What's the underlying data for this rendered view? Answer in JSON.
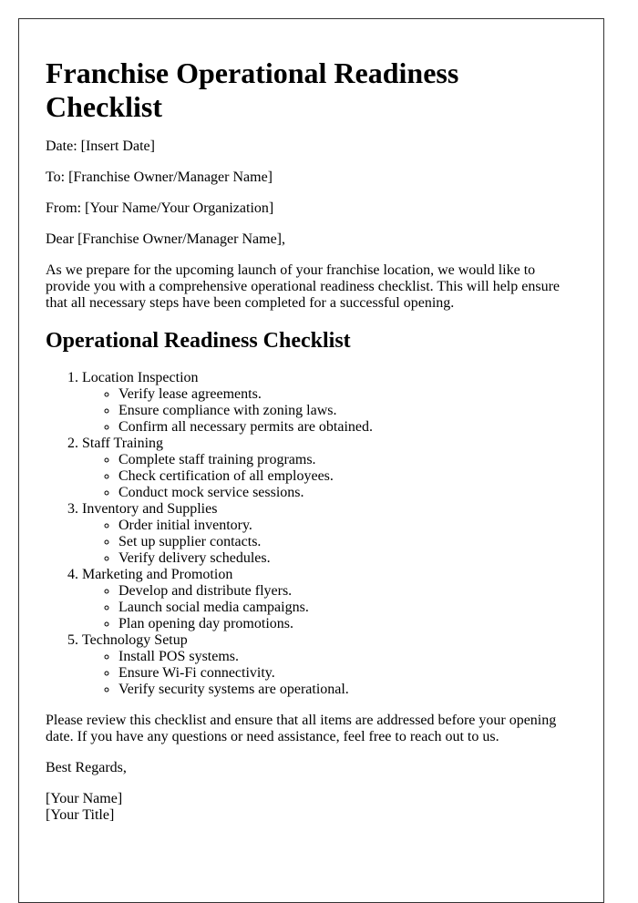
{
  "document": {
    "title": "Franchise Operational Readiness Checklist",
    "header_fields": [
      {
        "name": "date",
        "text": "Date: [Insert Date]"
      },
      {
        "name": "to",
        "text": "To: [Franchise Owner/Manager Name]"
      },
      {
        "name": "from",
        "text": "From: [Your Name/Your Organization]"
      }
    ],
    "salutation": "Dear [Franchise Owner/Manager Name],",
    "intro": "As we prepare for the upcoming launch of your franchise location, we would like to provide you with a comprehensive operational readiness checklist. This will help ensure that all necessary steps have been completed for a successful opening.",
    "section_heading": "Operational Readiness Checklist",
    "checklist": [
      {
        "title": "Location Inspection",
        "items": [
          "Verify lease agreements.",
          "Ensure compliance with zoning laws.",
          "Confirm all necessary permits are obtained."
        ]
      },
      {
        "title": "Staff Training",
        "items": [
          "Complete staff training programs.",
          "Check certification of all employees.",
          "Conduct mock service sessions."
        ]
      },
      {
        "title": "Inventory and Supplies",
        "items": [
          "Order initial inventory.",
          "Set up supplier contacts.",
          "Verify delivery schedules."
        ]
      },
      {
        "title": "Marketing and Promotion",
        "items": [
          "Develop and distribute flyers.",
          "Launch social media campaigns.",
          "Plan opening day promotions."
        ]
      },
      {
        "title": "Technology Setup",
        "items": [
          "Install POS systems.",
          "Ensure Wi-Fi connectivity.",
          "Verify security systems are operational."
        ]
      }
    ],
    "closing_paragraph": "Please review this checklist and ensure that all items are addressed before your opening date. If you have any questions or need assistance, feel free to reach out to us.",
    "sign_off": "Best Regards,",
    "signature": {
      "name": "[Your Name]",
      "title": "[Your Title]"
    }
  }
}
